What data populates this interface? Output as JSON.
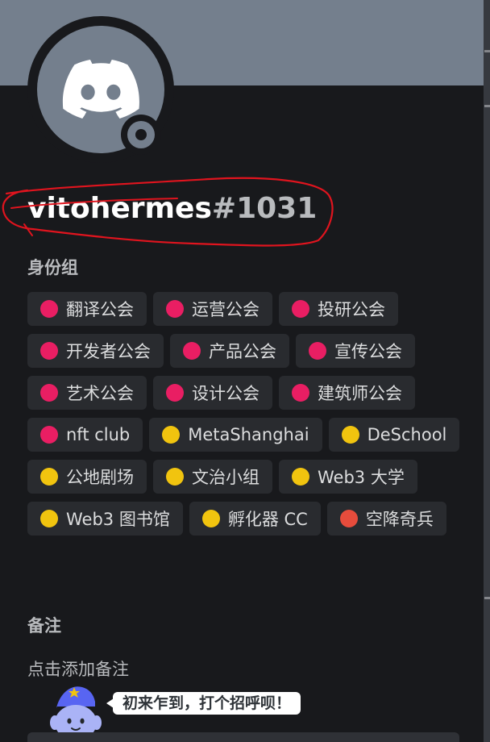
{
  "profile": {
    "username": "vitohermes",
    "discriminator": "#1031",
    "avatar_icon": "discord-logo-icon",
    "status": "offline",
    "banner_color": "#747f8d"
  },
  "roles_section": {
    "title": "身份组",
    "roles": [
      {
        "name": "翻译公会",
        "color": "#e91e63"
      },
      {
        "name": "运营公会",
        "color": "#e91e63"
      },
      {
        "name": "投研公会",
        "color": "#e91e63"
      },
      {
        "name": "开发者公会",
        "color": "#e91e63"
      },
      {
        "name": "产品公会",
        "color": "#e91e63"
      },
      {
        "name": "宣传公会",
        "color": "#e91e63"
      },
      {
        "name": "艺术公会",
        "color": "#e91e63"
      },
      {
        "name": "设计公会",
        "color": "#e91e63"
      },
      {
        "name": "建筑师公会",
        "color": "#e91e63"
      },
      {
        "name": "nft club",
        "color": "#e91e63"
      },
      {
        "name": "MetaShanghai",
        "color": "#f1c40f"
      },
      {
        "name": "DeSchool",
        "color": "#f1c40f"
      },
      {
        "name": "公地剧场",
        "color": "#f1c40f"
      },
      {
        "name": "文治小组",
        "color": "#f1c40f"
      },
      {
        "name": "Web3 大学",
        "color": "#f1c40f"
      },
      {
        "name": "Web3 图书馆",
        "color": "#f1c40f"
      },
      {
        "name": "孵化器 CC",
        "color": "#f1c40f"
      },
      {
        "name": "空降奇兵",
        "color": "#e74c3c"
      }
    ]
  },
  "note_section": {
    "title": "备注",
    "placeholder": "点击添加备注"
  },
  "wave": {
    "icon": "wumpus-mascot-icon",
    "bubble_text": "初来乍到，打个招呼呗！"
  }
}
